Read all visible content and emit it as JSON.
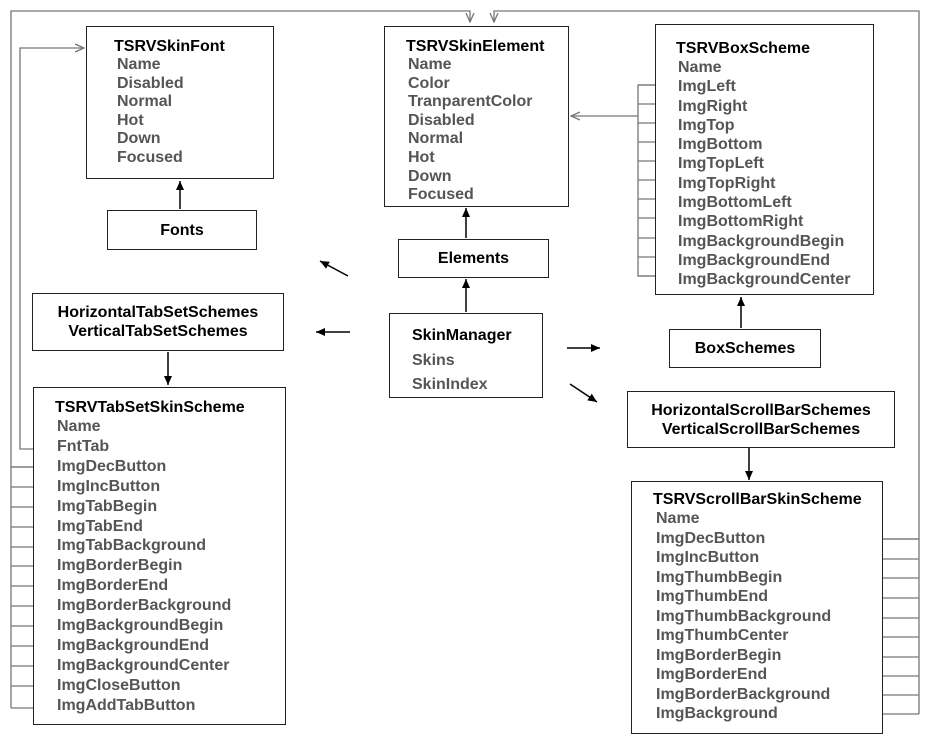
{
  "font": {
    "title": "TSRVSkinFont",
    "fields": [
      "Name",
      "Disabled",
      "Normal",
      "Hot",
      "Down",
      "Focused"
    ]
  },
  "element": {
    "title": "TSRVSkinElement",
    "fields": [
      "Name",
      "Color",
      "TranparentColor",
      "Disabled",
      "Normal",
      "Hot",
      "Down",
      "Focused"
    ]
  },
  "box": {
    "title": "TSRVBoxScheme",
    "fields": [
      "Name",
      "ImgLeft",
      "ImgRight",
      "ImgTop",
      "ImgBottom",
      "ImgTopLeft",
      "ImgTopRight",
      "ImgBottomLeft",
      "ImgBottomRight",
      "ImgBackgroundBegin",
      "ImgBackgroundEnd",
      "ImgBackgroundCenter"
    ]
  },
  "fonts_label": "Fonts",
  "elements_label": "Elements",
  "boxschemes_label": "BoxSchemes",
  "tabsets": {
    "line1": "HorizontalTabSetSchemes",
    "line2": "VerticalTabSetSchemes"
  },
  "scrollbars": {
    "line1": "HorizontalScrollBarSchemes",
    "line2": "VerticalScrollBarSchemes"
  },
  "manager": {
    "title": "SkinManager",
    "fields": [
      "Skins",
      "SkinIndex"
    ]
  },
  "tabset": {
    "title": "TSRVTabSetSkinScheme",
    "fields": [
      "Name",
      "FntTab",
      "ImgDecButton",
      "ImgIncButton",
      "ImgTabBegin",
      "ImgTabEnd",
      "ImgTabBackground",
      "ImgBorderBegin",
      "ImgBorderEnd",
      "ImgBorderBackground",
      "ImgBackgroundBegin",
      "ImgBackgroundEnd",
      "ImgBackgroundCenter",
      "ImgCloseButton",
      "ImgAddTabButton"
    ]
  },
  "scrollbar": {
    "title": "TSRVScrollBarSkinScheme",
    "fields": [
      "Name",
      "ImgDecButton",
      "ImgIncButton",
      "ImgThumbBegin",
      "ImgThumbEnd",
      "ImgThumbBackground",
      "ImgThumbCenter",
      "ImgBorderBegin",
      "ImgBorderEnd",
      "ImgBorderBackground",
      "ImgBackground"
    ]
  }
}
